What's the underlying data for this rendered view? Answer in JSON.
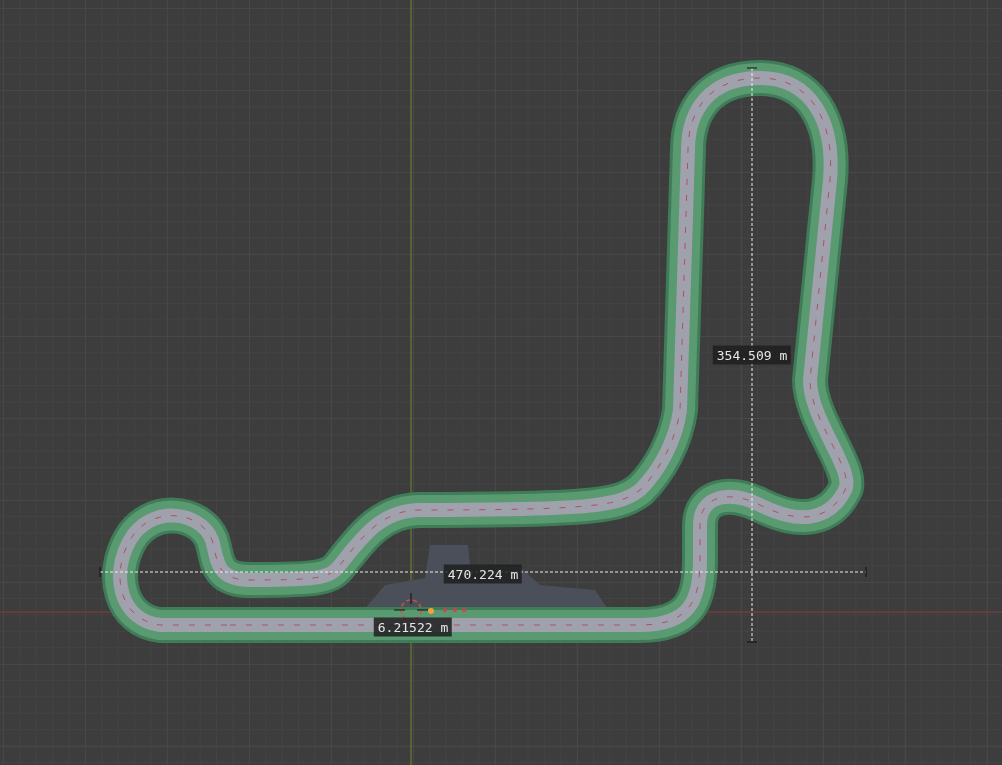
{
  "viewport": {
    "measurements": [
      {
        "reading": "354.509 m"
      },
      {
        "reading": "470.224 m"
      },
      {
        "reading": "6.21522 m"
      }
    ]
  }
}
